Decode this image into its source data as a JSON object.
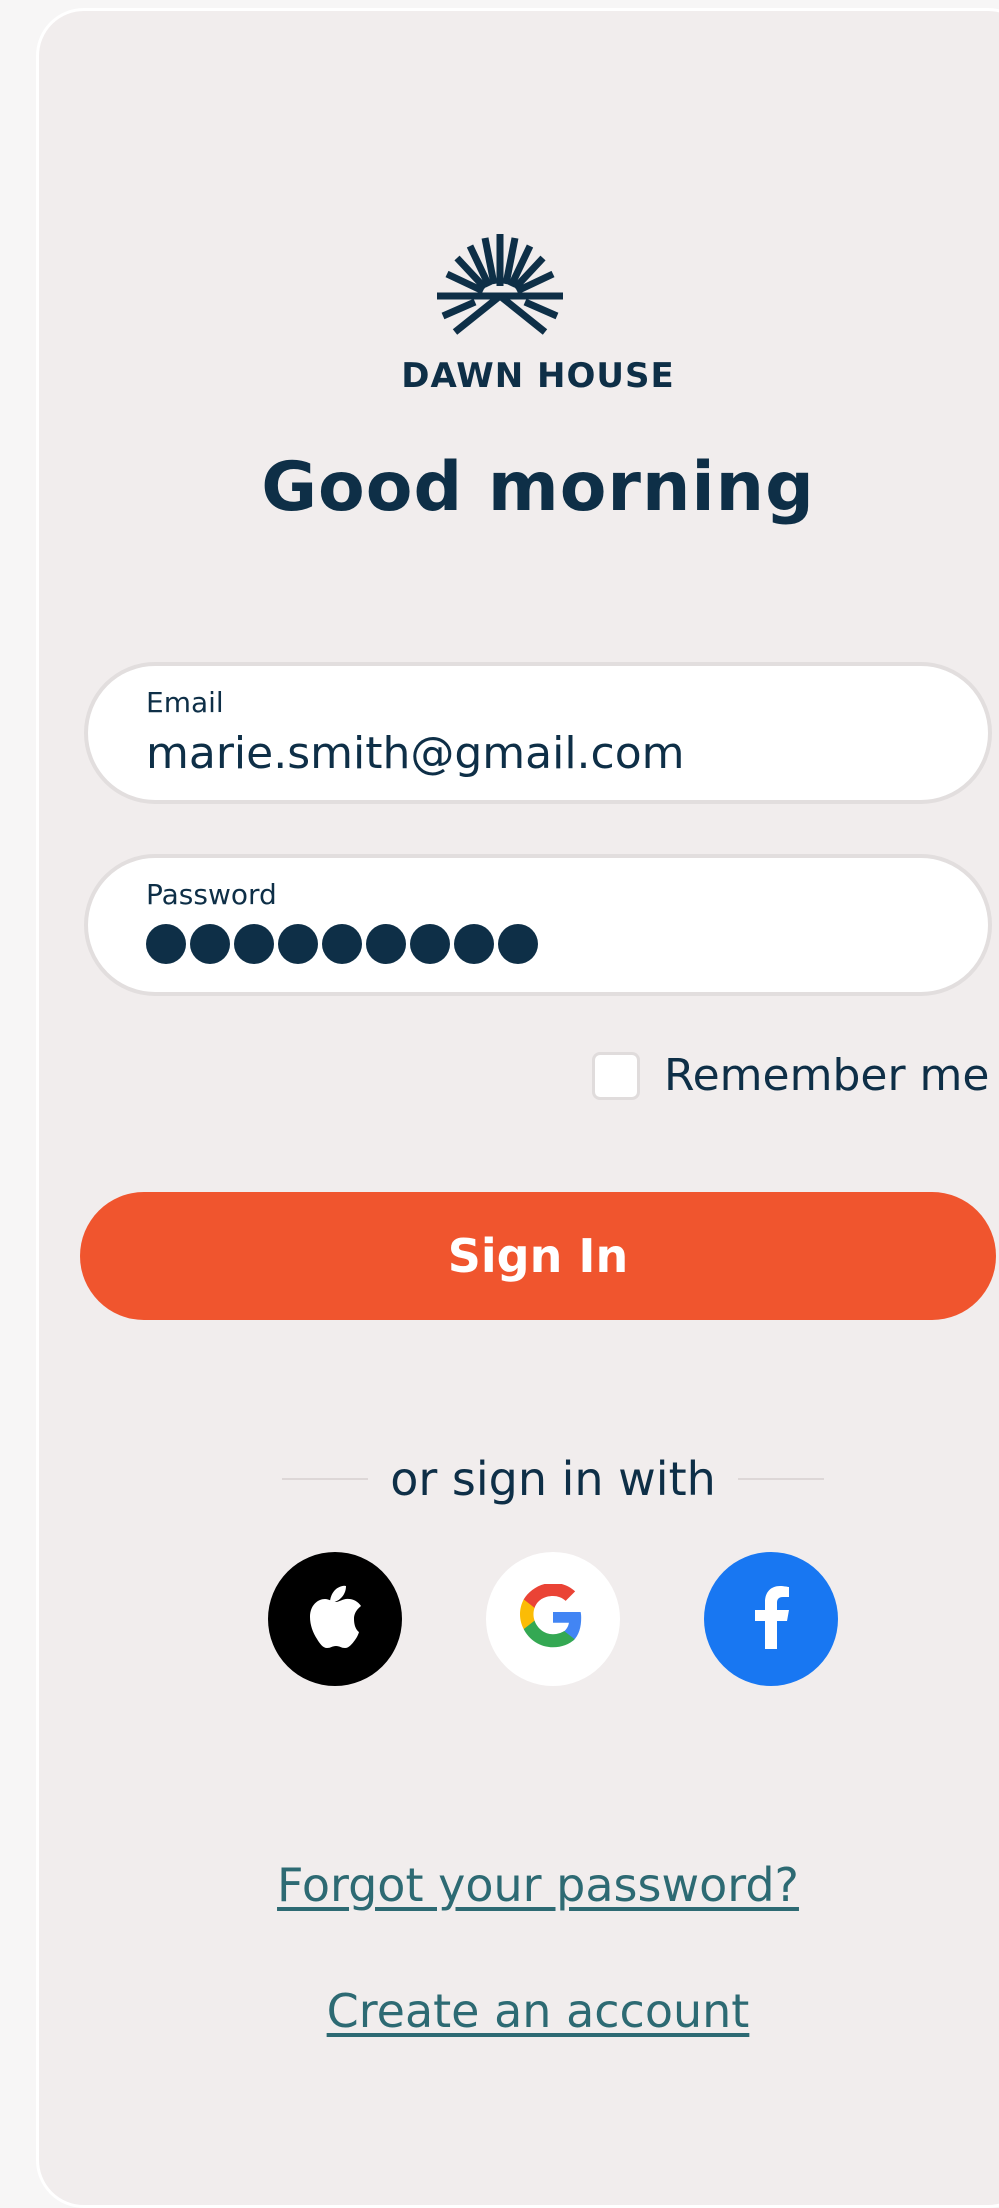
{
  "brand": {
    "name": "DAWN HOUSE",
    "logo_icon": "sunrise-icon"
  },
  "greeting": "Good morning",
  "form": {
    "email": {
      "label": "Email",
      "value": "marie.smith@gmail.com"
    },
    "password": {
      "label": "Password",
      "masked_length": 9
    },
    "remember_me": {
      "label": "Remember me",
      "checked": false
    },
    "sign_in_label": "Sign In"
  },
  "social": {
    "divider_text": "or sign in with",
    "providers": [
      {
        "name": "apple",
        "icon": "apple-icon",
        "color": "#000000"
      },
      {
        "name": "google",
        "icon": "google-icon",
        "color": "#ffffff"
      },
      {
        "name": "facebook",
        "icon": "facebook-icon",
        "color": "#1877f2"
      }
    ]
  },
  "links": {
    "forgot_password": "Forgot your password?",
    "create_account": "Create an account"
  },
  "colors": {
    "primary_text": "#0e2f47",
    "accent": "#f0552e",
    "link": "#2d6a73",
    "card_background": "#f1eded"
  }
}
